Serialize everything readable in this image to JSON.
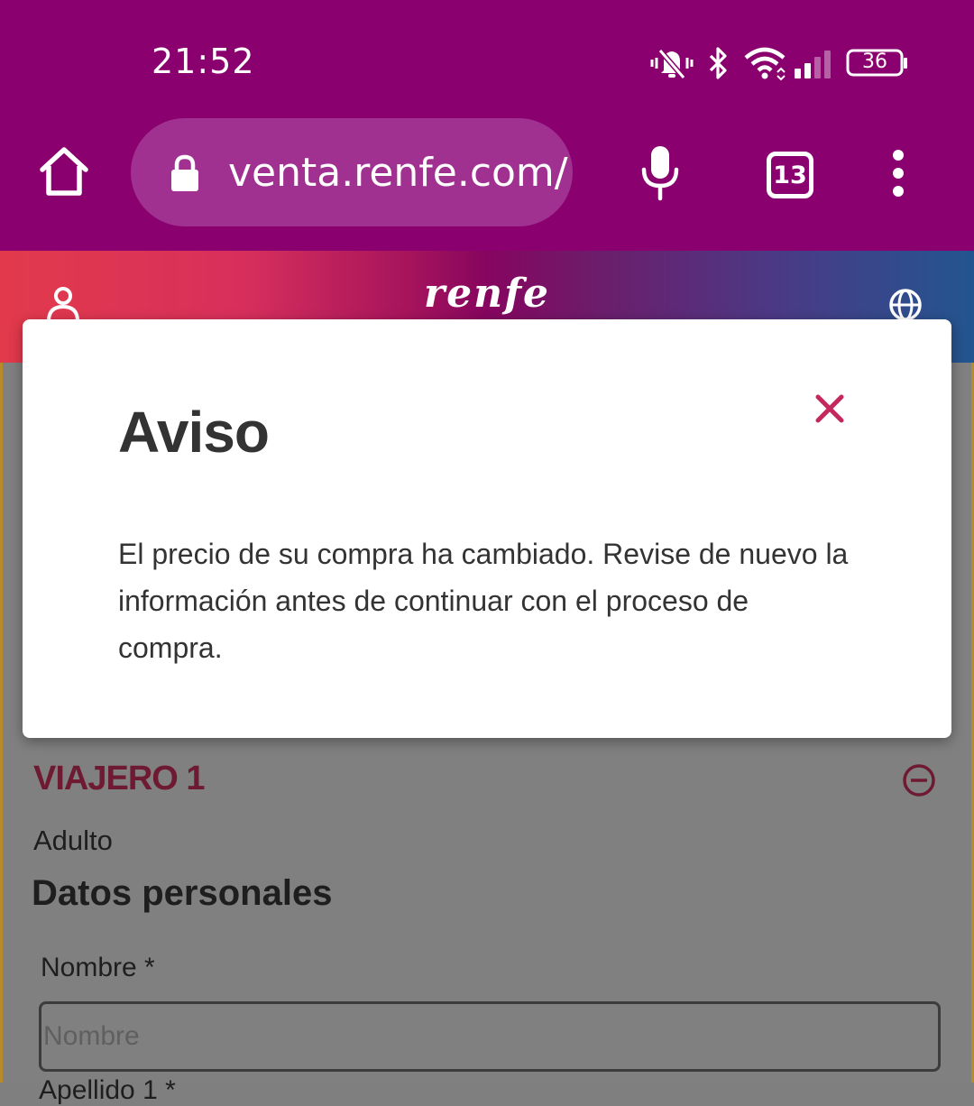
{
  "status_bar": {
    "time": "21:52",
    "battery": "36",
    "icons": [
      "mute-notifications-icon",
      "bluetooth-icon",
      "wifi-icon",
      "signal-icon",
      "battery-icon"
    ]
  },
  "browser": {
    "url": "venta.renfe.com/",
    "tab_count": "13",
    "icons": [
      "home-icon",
      "lock-icon",
      "mic-icon",
      "tabs-icon",
      "more-icon"
    ]
  },
  "site_header": {
    "logo_text": "renfe",
    "icons": [
      "user-icon",
      "globe-icon"
    ]
  },
  "modal": {
    "title": "Aviso",
    "body": "El precio de su compra ha cambiado. Revise de nuevo la información antes de continuar con el proceso de compra.",
    "close_icon": "close-icon",
    "accent_color": "#c4285d"
  },
  "form": {
    "traveler_title": "VIAJERO 1",
    "traveler_type": "Adulto",
    "section_title": "Datos personales",
    "name_label": "Nombre *",
    "name_placeholder": "Nombre",
    "name_value": "",
    "next_label_partial": "Apellido 1 *"
  },
  "colors": {
    "browser_bar": "#8a006e",
    "url_pill": "#a03191",
    "traveler_title": "#6e1a33"
  }
}
